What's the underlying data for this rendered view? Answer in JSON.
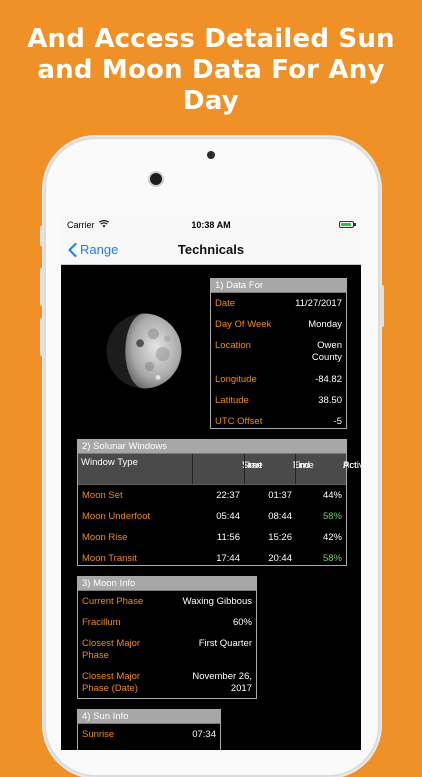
{
  "headline": {
    "line1": "And Access Detailed Sun",
    "line2": "and Moon Data For Any",
    "line3": "Day"
  },
  "status_bar": {
    "carrier": "Carrier",
    "time": "10:38 AM"
  },
  "nav": {
    "back_label": "Range",
    "title": "Technicals"
  },
  "data_for": {
    "header": "1) Data For",
    "rows": [
      {
        "label": "Date",
        "value": "11/27/2017"
      },
      {
        "label": "Day Of Week",
        "value": "Monday"
      },
      {
        "label": "Location",
        "value_line1": "Owen",
        "value_line2": "County"
      },
      {
        "label": "Longitude",
        "value": "-84.82"
      },
      {
        "label": "Latitude",
        "value": "38.50"
      },
      {
        "label": "UTC Offset",
        "value": "-5"
      }
    ]
  },
  "solunar": {
    "header": "2) Solunar Windows",
    "columns": {
      "type": "Window Type",
      "start_1": "Start",
      "start_2": "Time",
      "end_1": "End",
      "end_2": "Time",
      "pct_1": "Pct.",
      "pct_2": "Active"
    },
    "rows": [
      {
        "type": "Moon Set",
        "start": "22:37",
        "end": "01:37",
        "pct": "44%"
      },
      {
        "type": "Moon Underfoot",
        "start": "05:44",
        "end": "08:44",
        "pct": "58%"
      },
      {
        "type": "Moon Rise",
        "start": "11:56",
        "end": "15:26",
        "pct": "42%"
      },
      {
        "type": "Moon Transit",
        "start": "17:44",
        "end": "20:44",
        "pct": "58%"
      }
    ]
  },
  "moon_info": {
    "header": "3) Moon Info",
    "rows": [
      {
        "label": "Current Phase",
        "value": "Waxing Gibbous"
      },
      {
        "label": "Fracillum",
        "value": "60%"
      },
      {
        "label_line1": "Closest Major",
        "label_line2": "Phase",
        "value": "First Quarter"
      },
      {
        "label_line1": "Closest Major",
        "label_line2": "Phase (Date)",
        "value_line1": "November 26,",
        "value_line2": "2017"
      }
    ]
  },
  "sun_info": {
    "header": "4) Sun Info",
    "rows": [
      {
        "label": "Sunrise",
        "value": "07:34"
      }
    ]
  },
  "colors": {
    "background": "#ef9126",
    "label_orange": "#f08a1c",
    "high_activity_green": "#6ad36a",
    "link_blue": "#1b7cf5"
  }
}
